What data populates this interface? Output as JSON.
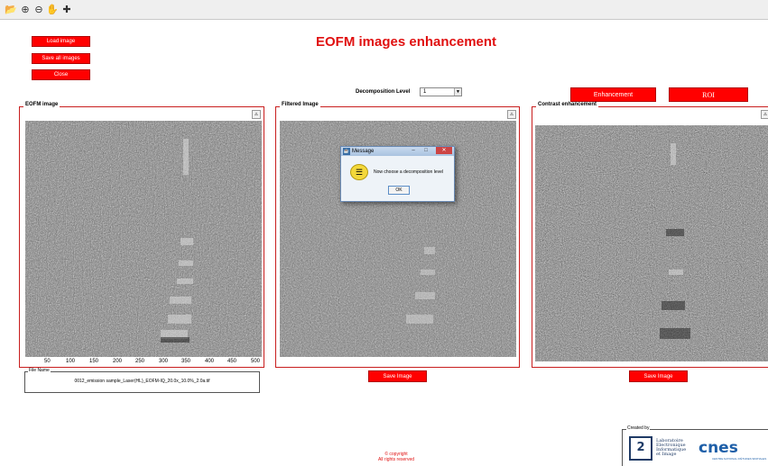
{
  "app": {
    "title": "EOFM images enhancement"
  },
  "toolbar": {
    "icons": [
      "open-folder-icon",
      "zoom-in-icon",
      "zoom-out-icon",
      "pan-hand-icon",
      "data-cursor-icon"
    ]
  },
  "buttons": {
    "load_image": "Load image",
    "save_all_images": "Save all images",
    "close": "Close",
    "enhancement": "Enhancement",
    "roi": "ROI",
    "save_image_filtered": "Save Image",
    "save_image_contrast": "Save Image"
  },
  "decomposition": {
    "label": "Decomposition Level",
    "selected": "1"
  },
  "panels": {
    "eofm": {
      "title": "EOFM image"
    },
    "filtered": {
      "title": "Filtered Image"
    },
    "contrast": {
      "title": "Contrast enhancement"
    }
  },
  "axis": {
    "ticks": [
      "50",
      "100",
      "150",
      "200",
      "250",
      "300",
      "350",
      "400",
      "450",
      "500"
    ]
  },
  "file": {
    "title": "File Name",
    "name": "0012_emission sample_Laser(HL)_EOFM-IQ_20.0x_10.0%_2.0a.tif"
  },
  "dialog": {
    "title": "Message",
    "message": "Now choose a decomposition level",
    "ok": "OK"
  },
  "footer": {
    "copyright_line1": "© copyright",
    "copyright_line2": "All rights reserved",
    "created_by": "Created by",
    "lab_lines": [
      "Laboratoire",
      "Electronique",
      "Informatique",
      "et Image"
    ],
    "cnes": "cnes",
    "cnes_sub": "CENTRE NATIONAL D'ÉTUDES SPATIALES"
  },
  "colors": {
    "accent": "#ff0000",
    "title": "#e01010",
    "panel_border": "#c81e1e"
  }
}
